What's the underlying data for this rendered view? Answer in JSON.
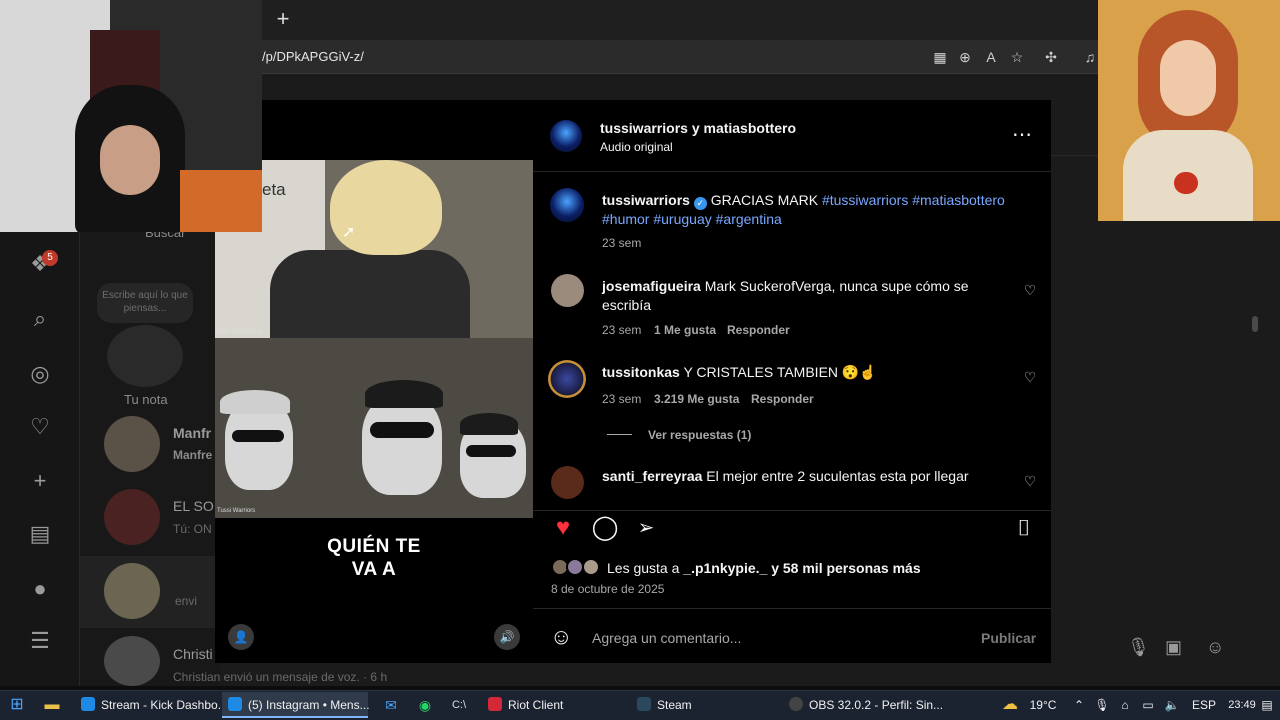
{
  "browser": {
    "new_tab_glyph": "+",
    "url": "/p/DPkAPGGiV-z/"
  },
  "sidebar": {
    "notification_count": "5"
  },
  "chat_list": {
    "search_placeholder": "Buscar",
    "note_prompt": "Escribe aquí lo que piensas...",
    "note_label": "Tu nota",
    "items": [
      {
        "name": "Manfr",
        "sub": "Manfre"
      },
      {
        "name": "EL SO",
        "sub": "Tú: ON"
      },
      {
        "name": "",
        "sub": "envi"
      },
      {
        "name": "Christi",
        "sub": "Christian envió un mensaje de voz. · 6 h"
      }
    ]
  },
  "video": {
    "top_caption": "eta",
    "top_label": "Mark Zuckerberg",
    "bottom_label": "Tussi Warriors",
    "overlay_line1": "QUIÉN TE",
    "overlay_line2": "VA A"
  },
  "post": {
    "header": {
      "authors": "tussiwarriors y matiasbottero",
      "audio": "Audio original"
    },
    "caption": {
      "user": "tussiwarriors",
      "text": "GRACIAS MARK",
      "tags_line1": "#tussiwarriors #matiasbottero",
      "tags_line2": "#humor #uruguay #argentina",
      "time": "23 sem"
    },
    "comments": [
      {
        "user": "josemafigueira",
        "text": "Mark SuckerofVerga, nunca supe cómo se",
        "text2": "escribía",
        "time": "23 sem",
        "likes": "1 Me gusta",
        "reply": "Responder"
      },
      {
        "user": "tussitonkas",
        "text": "Y CRISTALES TAMBIEN 😯☝",
        "time": "23 sem",
        "likes": "3.219 Me gusta",
        "reply": "Responder",
        "view_replies": "Ver respuestas (1)"
      },
      {
        "user": "santi_ferreyraa",
        "text": "El mejor entre 2 suculentas esta por llegar"
      }
    ],
    "likes_text": "Les gusta a ",
    "likes_user": "_.p1nkypie._",
    "likes_rest": " y 58 mil personas más",
    "date": "8 de octubre de 2025",
    "comment_placeholder": "Agrega un comentario...",
    "publish_label": "Publicar",
    "heart_color": "#ff3040"
  },
  "taskbar": {
    "items": [
      {
        "label": "Stream - Kick Dashbo...",
        "color": "#1f8ae6"
      },
      {
        "label": "(5) Instagram • Mens...",
        "color": "#1f8ae6"
      },
      {
        "label": "Riot Client",
        "color": "#d32936"
      },
      {
        "label": "Steam",
        "color": "#2a475e"
      },
      {
        "label": "OBS 32.0.2 - Perfil: Sin...",
        "color": "#444"
      }
    ],
    "weather": "19°C",
    "language": "ESP",
    "clock": "23:49"
  }
}
